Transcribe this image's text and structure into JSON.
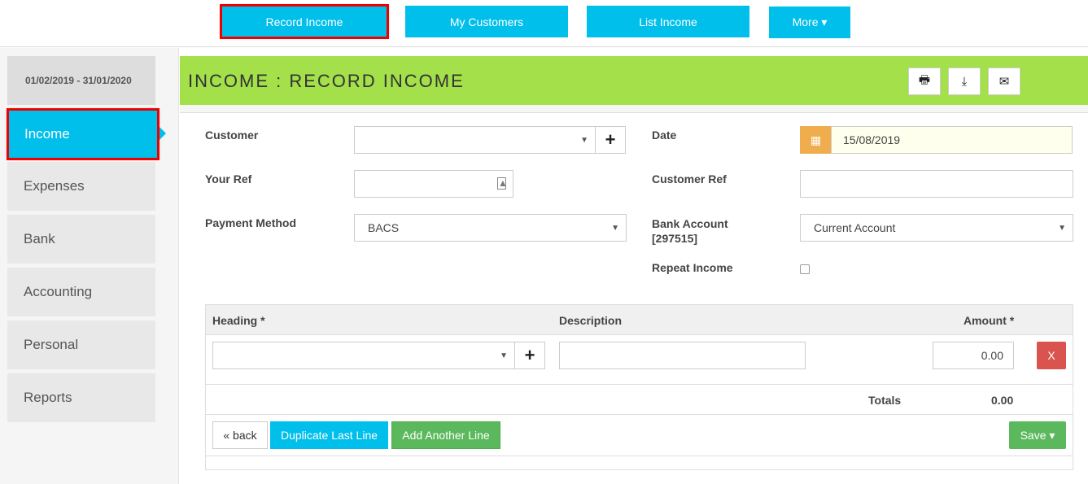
{
  "nav": {
    "record_income": "Record Income",
    "my_customers": "My Customers",
    "list_income": "List Income",
    "more": "More ▾"
  },
  "sidebar": {
    "date_range": "01/02/2019 - 31/01/2020",
    "items": [
      {
        "label": "Income"
      },
      {
        "label": "Expenses"
      },
      {
        "label": "Bank"
      },
      {
        "label": "Accounting"
      },
      {
        "label": "Personal"
      },
      {
        "label": "Reports"
      }
    ]
  },
  "header": {
    "title": "INCOME : RECORD INCOME"
  },
  "form": {
    "customer_label": "Customer",
    "customer_value": "",
    "date_label": "Date",
    "date_value": "15/08/2019",
    "your_ref_label": "Your Ref",
    "your_ref_value": "",
    "customer_ref_label": "Customer Ref",
    "customer_ref_value": "",
    "payment_method_label": "Payment Method",
    "payment_method_value": "BACS",
    "bank_account_label": "Bank Account",
    "bank_account_code": "[297515]",
    "bank_account_value": "Current Account",
    "repeat_income_label": "Repeat Income"
  },
  "table": {
    "heading_col": "Heading *",
    "description_col": "Description",
    "amount_col": "Amount *",
    "row": {
      "heading": "",
      "description": "",
      "amount": "0.00",
      "delete": "X"
    },
    "totals_label": "Totals",
    "totals_value": "0.00"
  },
  "actions": {
    "back": "« back",
    "duplicate": "Duplicate Last Line",
    "add_line": "Add Another Line",
    "save": "Save ▾"
  }
}
